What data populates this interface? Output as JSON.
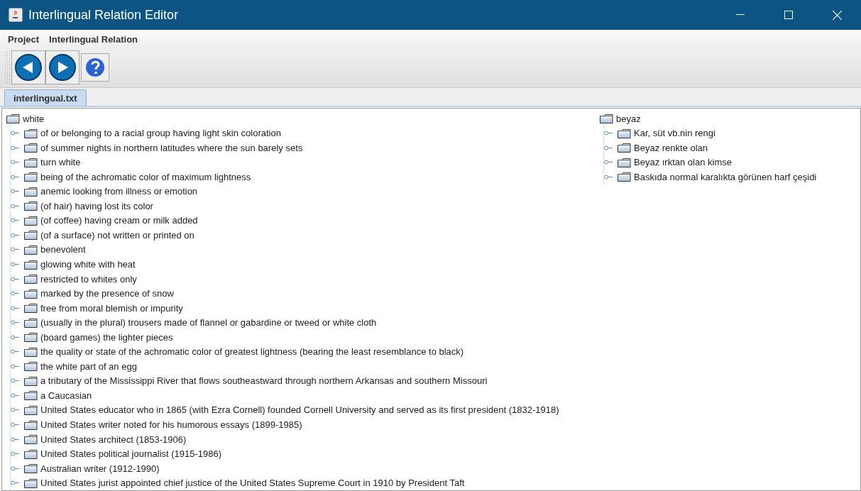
{
  "window": {
    "title": "Interlingual Relation Editor"
  },
  "menu": [
    "Project",
    "Interlingual Relation"
  ],
  "tabs": [
    {
      "label": "interlingual.txt",
      "selected": true
    }
  ],
  "trees": [
    {
      "label": "white",
      "children": [
        {
          "label": "of or belonging to a racial group having light skin coloration",
          "expanded": false
        },
        {
          "label": "of summer nights in northern latitudes where the sun barely sets",
          "expanded": false
        },
        {
          "label": "turn white",
          "expanded": false
        },
        {
          "label": "being of the achromatic color of maximum lightness",
          "expanded": false
        },
        {
          "label": "anemic looking from illness or emotion",
          "expanded": false
        },
        {
          "label": "(of hair) having lost its color",
          "expanded": false
        },
        {
          "label": "(of coffee) having cream or milk added",
          "expanded": false
        },
        {
          "label": "(of a surface) not written or printed on",
          "expanded": false
        },
        {
          "label": "benevolent",
          "expanded": false
        },
        {
          "label": "glowing white with heat",
          "expanded": false
        },
        {
          "label": "restricted to whites only",
          "expanded": false
        },
        {
          "label": "marked by the presence of snow",
          "expanded": false
        },
        {
          "label": "free from moral blemish or impurity",
          "expanded": false
        },
        {
          "label": "(usually in the plural) trousers made of flannel or gabardine or tweed or white cloth",
          "expanded": false
        },
        {
          "label": "(board games) the lighter pieces",
          "expanded": false
        },
        {
          "label": "the quality or state of the achromatic color of greatest lightness (bearing the least resemblance to black)",
          "expanded": false
        },
        {
          "label": "the white part of an egg",
          "expanded": false
        },
        {
          "label": "a tributary of the Mississippi River that flows southeastward through northern Arkansas and southern Missouri",
          "expanded": false
        },
        {
          "label": "a Caucasian",
          "expanded": false
        },
        {
          "label": "United States educator who in 1865 (with Ezra Cornell) founded Cornell University and served as its first president (1832-1918)",
          "expanded": false
        },
        {
          "label": "United States writer noted for his humorous essays (1899-1985)",
          "expanded": false
        },
        {
          "label": "United States architect (1853-1906)",
          "expanded": false
        },
        {
          "label": "United States political journalist (1915-1986)",
          "expanded": false
        },
        {
          "label": "Australian writer (1912-1990)",
          "expanded": false
        },
        {
          "label": "United States jurist appointed chief justice of the United States Supreme Court in 1910 by President Taft",
          "expanded": false
        }
      ]
    },
    {
      "label": "beyaz",
      "children": [
        {
          "label": "Kar, süt vb.nin rengi",
          "expanded": false
        },
        {
          "label": "Beyaz renkte olan",
          "expanded": false
        },
        {
          "label": "Beyaz ırktan olan kimse",
          "expanded": false
        },
        {
          "label": "Baskıda normal karalıkta görünen harf çeşidi",
          "expanded": false
        }
      ]
    }
  ]
}
